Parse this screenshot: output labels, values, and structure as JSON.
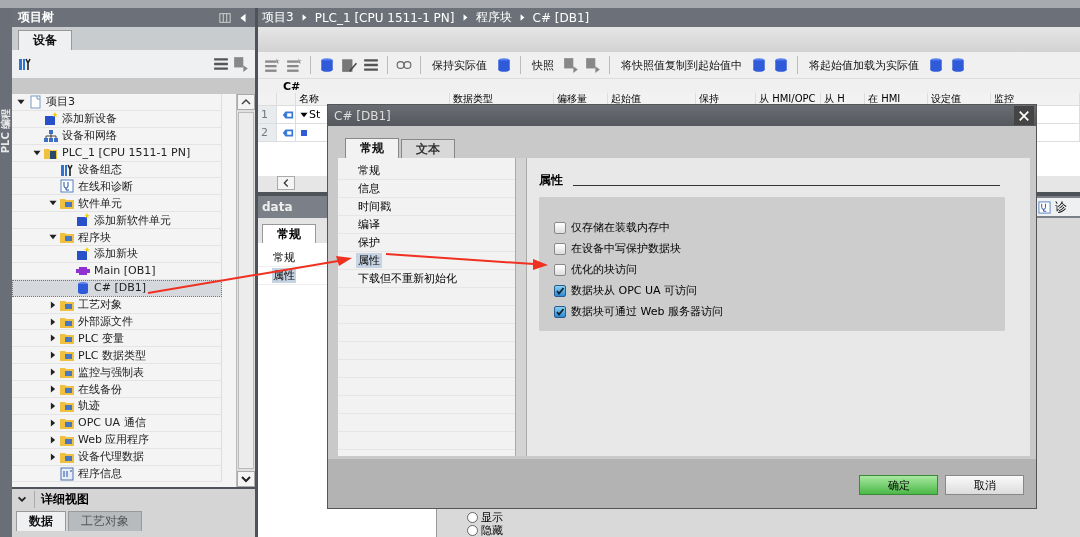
{
  "side_label": "PLC 编程",
  "project_tree": {
    "title": "项目树",
    "tabs": [
      {
        "label": "设备",
        "selected": true
      }
    ],
    "items": [
      {
        "label": "项目3",
        "kind": "project",
        "expanded": true,
        "selected": false,
        "children": [
          {
            "label": "添加新设备",
            "kind": "add",
            "selected": false
          },
          {
            "label": "设备和网络",
            "kind": "network",
            "selected": false
          },
          {
            "label": "PLC_1 [CPU 1511-1 PN]",
            "kind": "plc",
            "expanded": true,
            "selected": false,
            "children": [
              {
                "label": "设备组态",
                "kind": "config",
                "selected": false
              },
              {
                "label": "在线和诊断",
                "kind": "diagnostics",
                "selected": false
              },
              {
                "label": "软件单元",
                "kind": "folder",
                "expanded": true,
                "selected": false,
                "children": [
                  {
                    "label": "添加新软件单元",
                    "kind": "add",
                    "selected": false
                  }
                ]
              },
              {
                "label": "程序块",
                "kind": "folder",
                "expanded": true,
                "selected": false,
                "children": [
                  {
                    "label": "添加新块",
                    "kind": "add",
                    "selected": false
                  },
                  {
                    "label": "Main [OB1]",
                    "kind": "block",
                    "selected": false
                  },
                  {
                    "label": "C# [DB1]",
                    "kind": "database",
                    "selected": true
                  }
                ]
              },
              {
                "label": "工艺对象",
                "kind": "folder",
                "expanded": false,
                "selected": false
              },
              {
                "label": "外部源文件",
                "kind": "folder",
                "expanded": false,
                "selected": false
              },
              {
                "label": "PLC 变量",
                "kind": "folder",
                "expanded": false,
                "selected": false
              },
              {
                "label": "PLC 数据类型",
                "kind": "folder",
                "expanded": false,
                "selected": false
              },
              {
                "label": "监控与强制表",
                "kind": "folder",
                "expanded": false,
                "selected": false
              },
              {
                "label": "在线备份",
                "kind": "folder",
                "expanded": false,
                "selected": false
              },
              {
                "label": "轨迹",
                "kind": "folder",
                "expanded": false,
                "selected": false
              },
              {
                "label": "OPC UA 通信",
                "kind": "folder",
                "expanded": false,
                "selected": false
              },
              {
                "label": "Web 应用程序",
                "kind": "folder",
                "expanded": false,
                "selected": false
              },
              {
                "label": "设备代理数据",
                "kind": "folder",
                "expanded": false,
                "selected": false
              },
              {
                "label": "程序信息",
                "kind": "info",
                "selected": false
              }
            ]
          }
        ]
      }
    ]
  },
  "details_view": {
    "title": "详细视图",
    "tabs": [
      {
        "label": "数据",
        "selected": true
      },
      {
        "label": "工艺对象",
        "selected": false
      }
    ]
  },
  "breadcrumb": [
    "项目3",
    "PLC_1 [CPU 1511-1 PN]",
    "程序块",
    "C# [DB1]"
  ],
  "toolbar": [
    "保持实际值",
    "快照",
    "将快照值复制到起始值中",
    "将起始值加载为实际值"
  ],
  "block_name": "C#",
  "table": {
    "columns": [
      "名称",
      "数据类型",
      "偏移量",
      "起始值",
      "保持",
      "从 HMI/OPC",
      "从 H",
      "在 HMI",
      "设定值",
      "监控"
    ],
    "rows": [
      {
        "number": "1",
        "expanded": true,
        "name": "St"
      },
      {
        "number": "2",
        "name": ""
      }
    ]
  },
  "data_panel": {
    "title": "data",
    "tabs": [
      {
        "label": "常规",
        "selected": true
      }
    ],
    "items": [
      {
        "label": "常规",
        "selected": false
      },
      {
        "label": "属性",
        "selected": true
      }
    ],
    "right_tab": "诊"
  },
  "radios": [
    {
      "label": "显示",
      "selected": false
    },
    {
      "label": "隐藏",
      "selected": false
    }
  ],
  "dialog": {
    "title": "C# [DB1]",
    "tabs": [
      {
        "label": "常规",
        "selected": true
      },
      {
        "label": "文本",
        "selected": false
      }
    ],
    "nav": [
      {
        "label": "常规",
        "selected": false
      },
      {
        "label": "信息",
        "selected": false
      },
      {
        "label": "时间戳",
        "selected": false
      },
      {
        "label": "编译",
        "selected": false
      },
      {
        "label": "保护",
        "selected": false
      },
      {
        "label": "属性",
        "selected": true
      },
      {
        "label": "下载但不重新初始化",
        "selected": false
      }
    ],
    "section": "属性",
    "options": [
      {
        "label": "仅存储在装载内存中",
        "checked": false
      },
      {
        "label": "在设备中写保护数据块",
        "checked": false
      },
      {
        "label": "优化的块访问",
        "checked": false
      },
      {
        "label": "数据块从 OPC UA 可访问",
        "checked": true
      },
      {
        "label": "数据块可通过 Web 服务器访问",
        "checked": true
      }
    ],
    "buttons": [
      {
        "label": "确定",
        "kind": "primary"
      },
      {
        "label": "取消",
        "kind": "secondary"
      }
    ]
  }
}
